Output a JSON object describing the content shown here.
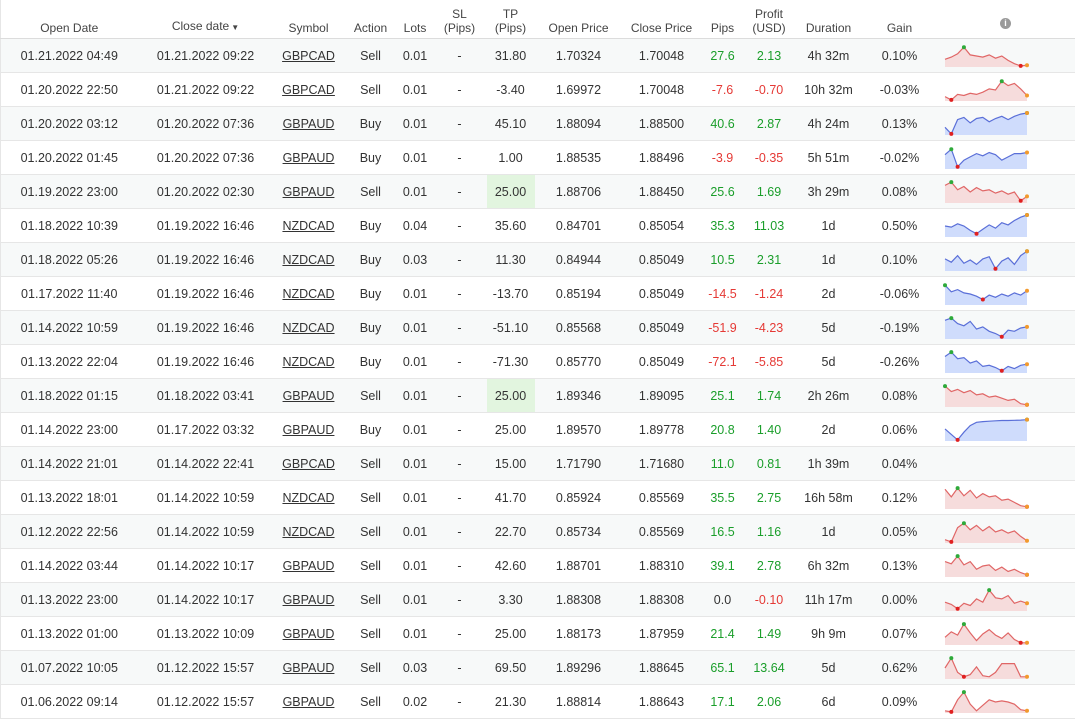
{
  "headers": {
    "open_date": "Open Date",
    "close_date": "Close date",
    "close_date_sort": "▼",
    "symbol": "Symbol",
    "action": "Action",
    "lots": "Lots",
    "sl_1": "SL",
    "sl_2": "(Pips)",
    "tp_1": "TP",
    "tp_2": "(Pips)",
    "open_price": "Open Price",
    "close_price": "Close Price",
    "pips": "Pips",
    "profit_1": "Profit",
    "profit_2": "(USD)",
    "duration": "Duration",
    "gain": "Gain",
    "info_icon": "i"
  },
  "colors": {
    "positive": "#1a9e2a",
    "negative": "#e53935",
    "sell_fill": "#f6dcdc",
    "sell_line": "#e06666",
    "buy_fill": "#cfdcfc",
    "buy_line": "#5a6fd8",
    "marker_high": "#2eaa3a",
    "marker_low": "#e02020",
    "marker_end": "#f29a2e"
  },
  "rows": [
    {
      "open": "01.21.2022 04:49",
      "close": "01.21.2022 09:22",
      "symbol": "GBPCAD",
      "action": "Sell",
      "lots": "0.01",
      "sl": "-",
      "tp": "31.80",
      "open_price": "1.70324",
      "close_price": "1.70048",
      "pips": "27.6",
      "profit": "2.13",
      "duration": "4h 32m",
      "gain": "0.10%",
      "tp_highlight": false,
      "spark": [
        0.35,
        0.45,
        0.6,
        0.9,
        0.55,
        0.5,
        0.45,
        0.55,
        0.4,
        0.5,
        0.3,
        0.15,
        0.05,
        0.08
      ]
    },
    {
      "open": "01.20.2022 22:50",
      "close": "01.21.2022 09:22",
      "symbol": "GBPCAD",
      "action": "Sell",
      "lots": "0.01",
      "sl": "-",
      "tp": "-3.40",
      "open_price": "1.69972",
      "close_price": "1.70048",
      "pips": "-7.6",
      "profit": "-0.70",
      "duration": "10h 32m",
      "gain": "-0.03%",
      "tp_highlight": false,
      "spark": [
        0.2,
        0.05,
        0.3,
        0.25,
        0.35,
        0.3,
        0.4,
        0.55,
        0.5,
        0.9,
        0.7,
        0.8,
        0.55,
        0.25
      ]
    },
    {
      "open": "01.20.2022 03:12",
      "close": "01.20.2022 07:36",
      "symbol": "GBPAUD",
      "action": "Buy",
      "lots": "0.01",
      "sl": "-",
      "tp": "45.10",
      "open_price": "1.88094",
      "close_price": "1.88500",
      "pips": "40.6",
      "profit": "2.87",
      "duration": "4h 24m",
      "gain": "0.13%",
      "tp_highlight": false,
      "spark": [
        0.35,
        0.05,
        0.7,
        0.8,
        0.55,
        0.75,
        0.8,
        0.6,
        0.75,
        0.85,
        0.7,
        0.85,
        0.95,
        1.0
      ]
    },
    {
      "open": "01.20.2022 01:45",
      "close": "01.20.2022 07:36",
      "symbol": "GBPAUD",
      "action": "Buy",
      "lots": "0.01",
      "sl": "-",
      "tp": "1.00",
      "open_price": "1.88535",
      "close_price": "1.88496",
      "pips": "-3.9",
      "profit": "-0.35",
      "duration": "5h 51m",
      "gain": "-0.02%",
      "tp_highlight": false,
      "spark": [
        0.65,
        0.9,
        0.1,
        0.4,
        0.55,
        0.7,
        0.6,
        0.75,
        0.65,
        0.4,
        0.55,
        0.7,
        0.7,
        0.75
      ]
    },
    {
      "open": "01.19.2022 23:00",
      "close": "01.20.2022 02:30",
      "symbol": "GBPAUD",
      "action": "Sell",
      "lots": "0.01",
      "sl": "-",
      "tp": "25.00",
      "open_price": "1.88706",
      "close_price": "1.88450",
      "pips": "25.6",
      "profit": "1.69",
      "duration": "3h 29m",
      "gain": "0.08%",
      "tp_highlight": true,
      "spark": [
        0.8,
        0.95,
        0.6,
        0.75,
        0.5,
        0.7,
        0.55,
        0.6,
        0.45,
        0.55,
        0.4,
        0.5,
        0.1,
        0.3
      ]
    },
    {
      "open": "01.18.2022 10:39",
      "close": "01.19.2022 16:46",
      "symbol": "NZDCAD",
      "action": "Buy",
      "lots": "0.04",
      "sl": "-",
      "tp": "35.60",
      "open_price": "0.84701",
      "close_price": "0.85054",
      "pips": "35.3",
      "profit": "11.03",
      "duration": "1d",
      "gain": "0.50%",
      "tp_highlight": false,
      "spark": [
        0.5,
        0.45,
        0.6,
        0.5,
        0.3,
        0.15,
        0.35,
        0.55,
        0.4,
        0.65,
        0.55,
        0.75,
        0.9,
        1.0
      ]
    },
    {
      "open": "01.18.2022 05:26",
      "close": "01.19.2022 16:46",
      "symbol": "NZDCAD",
      "action": "Buy",
      "lots": "0.03",
      "sl": "-",
      "tp": "11.30",
      "open_price": "0.84944",
      "close_price": "0.85049",
      "pips": "10.5",
      "profit": "2.31",
      "duration": "1d",
      "gain": "0.10%",
      "tp_highlight": false,
      "spark": [
        0.55,
        0.4,
        0.7,
        0.35,
        0.5,
        0.3,
        0.55,
        0.65,
        0.1,
        0.45,
        0.6,
        0.3,
        0.7,
        0.9
      ]
    },
    {
      "open": "01.17.2022 11:40",
      "close": "01.19.2022 16:46",
      "symbol": "NZDCAD",
      "action": "Buy",
      "lots": "0.01",
      "sl": "-",
      "tp": "-13.70",
      "open_price": "0.85194",
      "close_price": "0.85049",
      "pips": "-14.5",
      "profit": "-1.24",
      "duration": "2d",
      "gain": "-0.06%",
      "tp_highlight": false,
      "spark": [
        0.9,
        0.6,
        0.7,
        0.55,
        0.5,
        0.4,
        0.25,
        0.45,
        0.35,
        0.5,
        0.4,
        0.55,
        0.45,
        0.65
      ]
    },
    {
      "open": "01.14.2022 10:59",
      "close": "01.19.2022 16:46",
      "symbol": "NZDCAD",
      "action": "Buy",
      "lots": "0.01",
      "sl": "-",
      "tp": "-51.10",
      "open_price": "0.85568",
      "close_price": "0.85049",
      "pips": "-51.9",
      "profit": "-4.23",
      "duration": "5d",
      "gain": "-0.19%",
      "tp_highlight": false,
      "spark": [
        0.85,
        0.95,
        0.7,
        0.6,
        0.8,
        0.45,
        0.55,
        0.35,
        0.25,
        0.1,
        0.4,
        0.35,
        0.5,
        0.55
      ]
    },
    {
      "open": "01.13.2022 22:04",
      "close": "01.19.2022 16:46",
      "symbol": "NZDCAD",
      "action": "Buy",
      "lots": "0.01",
      "sl": "-",
      "tp": "-71.30",
      "open_price": "0.85770",
      "close_price": "0.85049",
      "pips": "-72.1",
      "profit": "-5.85",
      "duration": "5d",
      "gain": "-0.26%",
      "tp_highlight": false,
      "spark": [
        0.75,
        0.95,
        0.65,
        0.7,
        0.45,
        0.55,
        0.3,
        0.35,
        0.25,
        0.1,
        0.3,
        0.2,
        0.35,
        0.4
      ]
    },
    {
      "open": "01.18.2022 01:15",
      "close": "01.18.2022 03:41",
      "symbol": "GBPAUD",
      "action": "Sell",
      "lots": "0.01",
      "sl": "-",
      "tp": "25.00",
      "open_price": "1.89346",
      "close_price": "1.89095",
      "pips": "25.1",
      "profit": "1.74",
      "duration": "2h 26m",
      "gain": "0.08%",
      "tp_highlight": true,
      "spark": [
        0.95,
        0.7,
        0.8,
        0.65,
        0.75,
        0.55,
        0.6,
        0.45,
        0.5,
        0.4,
        0.3,
        0.35,
        0.15,
        0.1
      ]
    },
    {
      "open": "01.14.2022 23:00",
      "close": "01.17.2022 03:32",
      "symbol": "GBPAUD",
      "action": "Buy",
      "lots": "0.01",
      "sl": "-",
      "tp": "25.00",
      "open_price": "1.89570",
      "close_price": "1.89778",
      "pips": "20.8",
      "profit": "1.40",
      "duration": "2d",
      "gain": "0.06%",
      "tp_highlight": false,
      "spark": [
        0.55,
        0.3,
        0.05,
        0.4,
        0.7,
        0.85,
        0.88,
        0.9,
        0.92,
        0.93,
        0.93,
        0.94,
        0.95,
        0.97
      ]
    },
    {
      "open": "01.14.2022 21:01",
      "close": "01.14.2022 22:41",
      "symbol": "GBPCAD",
      "action": "Sell",
      "lots": "0.01",
      "sl": "-",
      "tp": "15.00",
      "open_price": "1.71790",
      "close_price": "1.71680",
      "pips": "11.0",
      "profit": "0.81",
      "duration": "1h 39m",
      "gain": "0.04%",
      "tp_highlight": false,
      "spark": null
    },
    {
      "open": "01.13.2022 18:01",
      "close": "01.14.2022 10:59",
      "symbol": "NZDCAD",
      "action": "Sell",
      "lots": "0.01",
      "sl": "-",
      "tp": "41.70",
      "open_price": "0.85924",
      "close_price": "0.85569",
      "pips": "35.5",
      "profit": "2.75",
      "duration": "16h 58m",
      "gain": "0.12%",
      "tp_highlight": false,
      "spark": [
        0.9,
        0.55,
        0.95,
        0.6,
        0.85,
        0.5,
        0.7,
        0.55,
        0.6,
        0.4,
        0.45,
        0.3,
        0.15,
        0.1
      ]
    },
    {
      "open": "01.12.2022 22:56",
      "close": "01.14.2022 10:59",
      "symbol": "NZDCAD",
      "action": "Sell",
      "lots": "0.01",
      "sl": "-",
      "tp": "22.70",
      "open_price": "0.85734",
      "close_price": "0.85569",
      "pips": "16.5",
      "profit": "1.16",
      "duration": "1d",
      "gain": "0.05%",
      "tp_highlight": false,
      "spark": [
        0.15,
        0.05,
        0.7,
        0.9,
        0.6,
        0.8,
        0.55,
        0.75,
        0.5,
        0.6,
        0.45,
        0.55,
        0.3,
        0.1
      ]
    },
    {
      "open": "01.14.2022 03:44",
      "close": "01.14.2022 10:17",
      "symbol": "GBPAUD",
      "action": "Sell",
      "lots": "0.01",
      "sl": "-",
      "tp": "42.60",
      "open_price": "1.88701",
      "close_price": "1.88310",
      "pips": "39.1",
      "profit": "2.78",
      "duration": "6h 32m",
      "gain": "0.13%",
      "tp_highlight": false,
      "spark": [
        0.7,
        0.6,
        0.95,
        0.55,
        0.7,
        0.35,
        0.5,
        0.55,
        0.3,
        0.45,
        0.25,
        0.35,
        0.2,
        0.1
      ]
    },
    {
      "open": "01.13.2022 23:00",
      "close": "01.14.2022 10:17",
      "symbol": "GBPAUD",
      "action": "Sell",
      "lots": "0.01",
      "sl": "-",
      "tp": "3.30",
      "open_price": "1.88308",
      "close_price": "1.88308",
      "pips": "0.0",
      "profit": "-0.10",
      "duration": "11h 17m",
      "gain": "0.00%",
      "tp_highlight": false,
      "spark": [
        0.4,
        0.3,
        0.1,
        0.35,
        0.25,
        0.55,
        0.4,
        0.95,
        0.6,
        0.55,
        0.7,
        0.35,
        0.45,
        0.35
      ]
    },
    {
      "open": "01.13.2022 01:00",
      "close": "01.13.2022 10:09",
      "symbol": "GBPAUD",
      "action": "Sell",
      "lots": "0.01",
      "sl": "-",
      "tp": "25.00",
      "open_price": "1.88173",
      "close_price": "1.87959",
      "pips": "21.4",
      "profit": "1.49",
      "duration": "9h 9m",
      "gain": "0.07%",
      "tp_highlight": false,
      "spark": [
        0.35,
        0.6,
        0.45,
        0.95,
        0.55,
        0.2,
        0.5,
        0.7,
        0.45,
        0.3,
        0.55,
        0.25,
        0.1,
        0.1
      ]
    },
    {
      "open": "01.07.2022 10:05",
      "close": "01.12.2022 15:57",
      "symbol": "GBPAUD",
      "action": "Sell",
      "lots": "0.03",
      "sl": "-",
      "tp": "69.50",
      "open_price": "1.89296",
      "close_price": "1.88645",
      "pips": "65.1",
      "profit": "13.64",
      "duration": "5d",
      "gain": "0.62%",
      "tp_highlight": false,
      "spark": [
        0.5,
        0.95,
        0.3,
        0.1,
        0.2,
        0.55,
        0.15,
        0.1,
        0.3,
        0.7,
        0.7,
        0.7,
        0.1,
        0.1
      ]
    },
    {
      "open": "01.06.2022 09:14",
      "close": "01.12.2022 15:57",
      "symbol": "GBPAUD",
      "action": "Sell",
      "lots": "0.02",
      "sl": "-",
      "tp": "21.30",
      "open_price": "1.88814",
      "close_price": "1.88643",
      "pips": "17.1",
      "profit": "2.06",
      "duration": "6d",
      "gain": "0.09%",
      "tp_highlight": false,
      "spark": [
        0.1,
        0.05,
        0.6,
        0.95,
        0.4,
        0.1,
        0.35,
        0.6,
        0.5,
        0.55,
        0.5,
        0.4,
        0.15,
        0.1
      ]
    }
  ]
}
